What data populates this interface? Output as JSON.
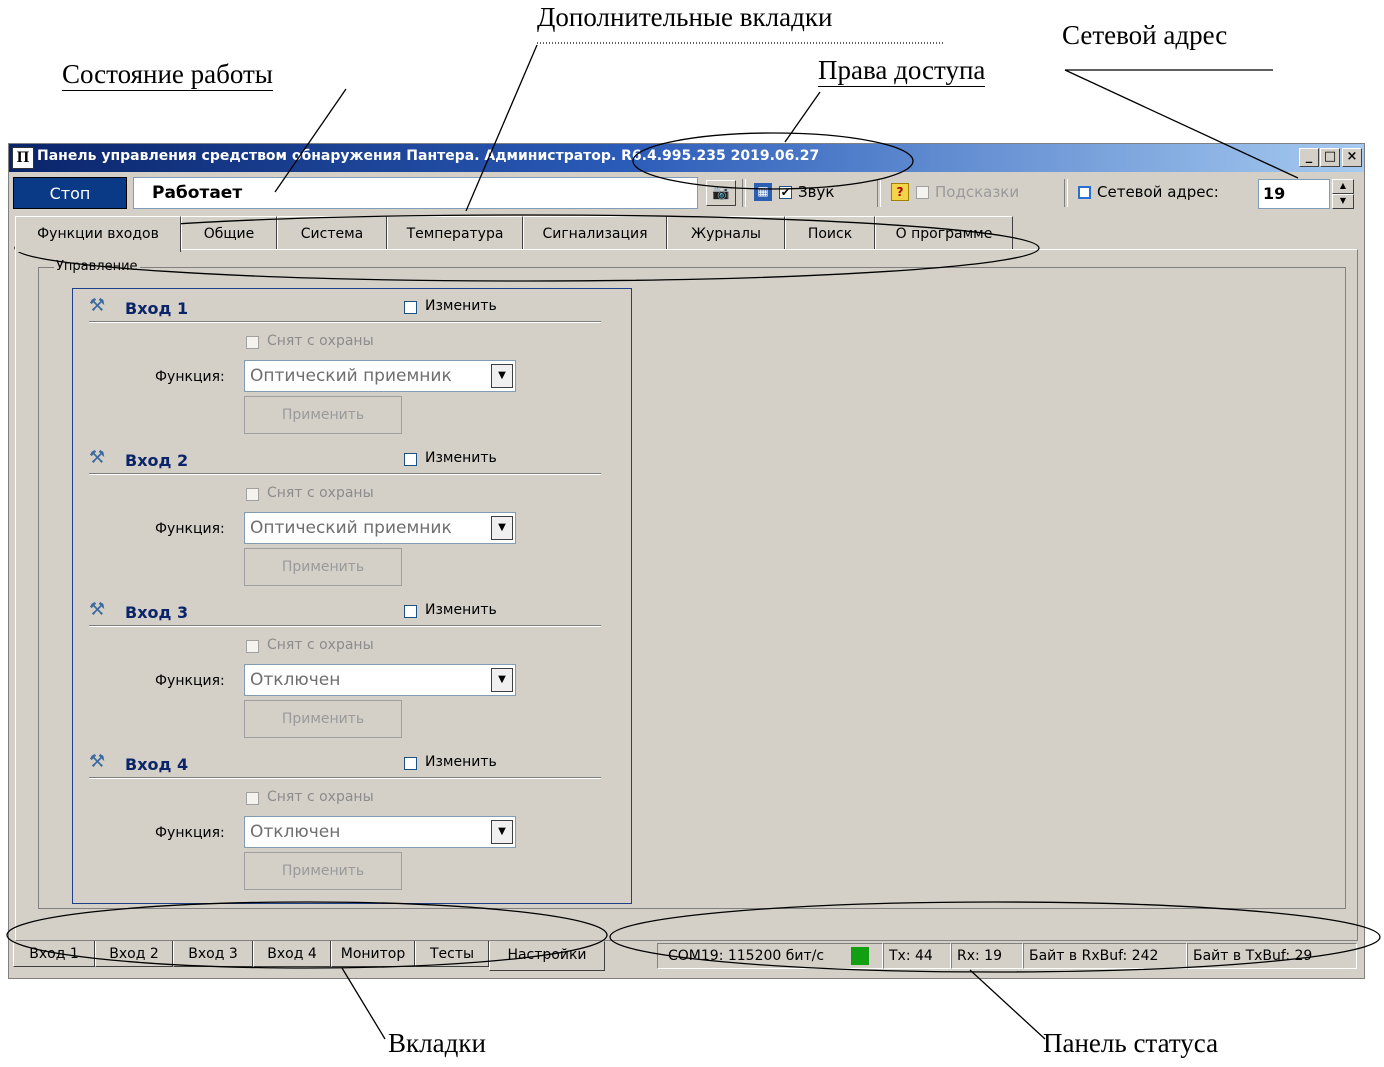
{
  "annotations": {
    "state": "Состояние работы",
    "extra_tabs": "Дополнительные вкладки",
    "access": "Права доступа",
    "net_address": "Сетевой адрес",
    "tabs": "Вкладки",
    "status_panel": "Панель статуса"
  },
  "window": {
    "title": "Панель управления средством обнаружения Пантера. Администратор. R6.4.995.235 2019.06.27",
    "min": "_",
    "max": "□",
    "close": "×"
  },
  "toolbar": {
    "stop_label": "Стоп",
    "state_value": "Работает",
    "sound_label": "Звук",
    "sound_checked": "✔",
    "hints_label": "Подсказки",
    "net_address_label": "Сетевой адрес:",
    "net_address_value": "19"
  },
  "top_tabs": [
    "Функции входов",
    "Общие",
    "Система",
    "Температура",
    "Сигнализация",
    "Журналы",
    "Поиск",
    "О программе"
  ],
  "group_title": "Управление",
  "inputs": [
    {
      "title": "Вход 1",
      "change": "Изменить",
      "disarmed": "Снят с охраны",
      "function_label": "Функция:",
      "function_value": "Оптический приемник",
      "apply": "Применить"
    },
    {
      "title": "Вход 2",
      "change": "Изменить",
      "disarmed": "Снят с охраны",
      "function_label": "Функция:",
      "function_value": "Оптический приемник",
      "apply": "Применить"
    },
    {
      "title": "Вход 3",
      "change": "Изменить",
      "disarmed": "Снят с охраны",
      "function_label": "Функция:",
      "function_value": "Отключен",
      "apply": "Применить"
    },
    {
      "title": "Вход 4",
      "change": "Изменить",
      "disarmed": "Снят с охраны",
      "function_label": "Функция:",
      "function_value": "Отключен",
      "apply": "Применить"
    }
  ],
  "bottom_tabs": [
    "Вход 1",
    "Вход 2",
    "Вход 3",
    "Вход 4",
    "Монитор",
    "Тесты",
    "Настройки"
  ],
  "statusbar": {
    "port": "COM19: 115200 бит/с",
    "tx": "Tx: 44",
    "rx": "Rx: 19",
    "rxbuf": "Байт в RxBuf:   242",
    "txbuf": "Байт в TxBuf:   29",
    "led_color": "#12a012"
  }
}
